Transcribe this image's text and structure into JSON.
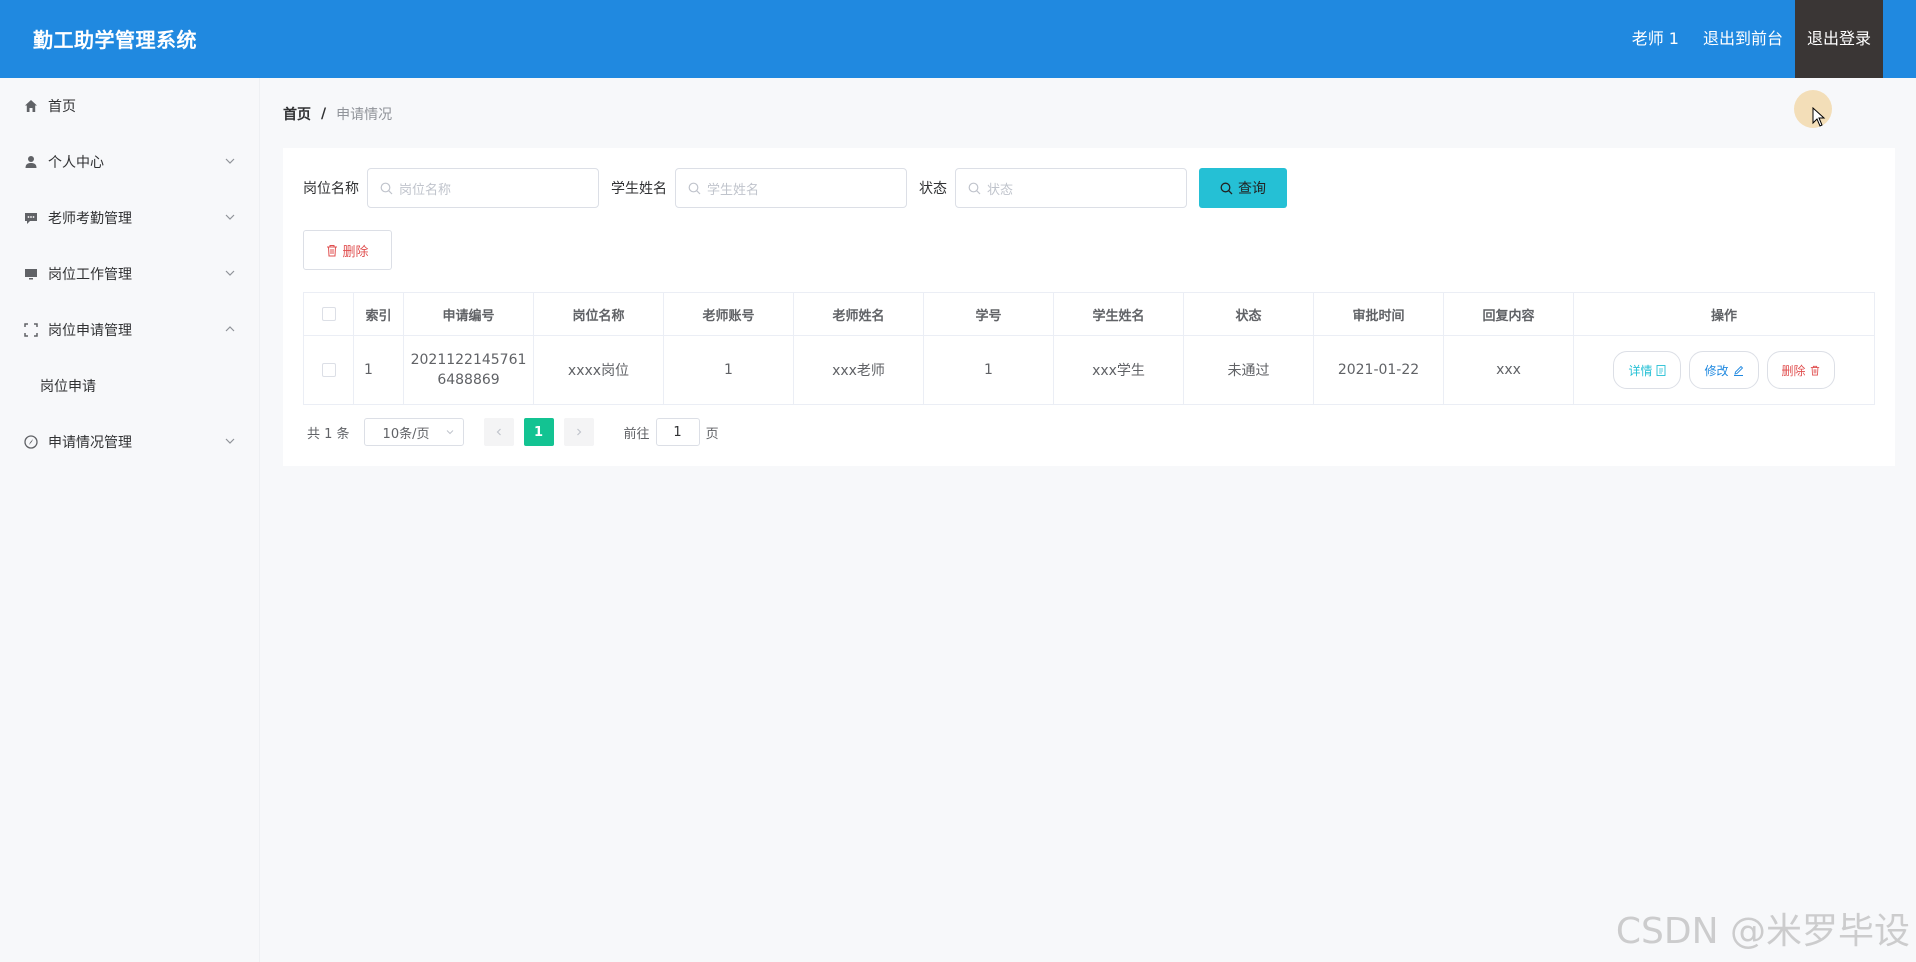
{
  "header": {
    "title": "勤工助学管理系统",
    "user": "老师 1",
    "front_link": "退出到前台",
    "logout": "退出登录",
    "bg_color": "#2089e0"
  },
  "sidebar": {
    "items": [
      {
        "label": "首页",
        "icon": "home-icon"
      },
      {
        "label": "个人中心",
        "icon": "user-icon"
      },
      {
        "label": "老师考勤管理",
        "icon": "chat-icon"
      },
      {
        "label": "岗位工作管理",
        "icon": "monitor-icon"
      },
      {
        "label": "岗位申请管理",
        "icon": "fullscreen-icon",
        "sub": [
          "岗位申请"
        ]
      },
      {
        "label": "申请情况管理",
        "icon": "compass-icon"
      }
    ]
  },
  "breadcrumb": {
    "home": "首页",
    "sep": "/",
    "current": "申请情况"
  },
  "search": {
    "job_label": "岗位名称",
    "job_placeholder": "岗位名称",
    "student_label": "学生姓名",
    "student_placeholder": "学生姓名",
    "status_label": "状态",
    "status_placeholder": "状态",
    "button": "查询"
  },
  "toolbar": {
    "delete": "删除"
  },
  "table": {
    "headers": [
      "索引",
      "申请编号",
      "岗位名称",
      "老师账号",
      "老师姓名",
      "学号",
      "学生姓名",
      "状态",
      "审批时间",
      "回复内容",
      "操作"
    ],
    "rows": [
      {
        "index": "1",
        "app_no_1": "2021122145761",
        "app_no_2": "6488869",
        "job": "xxxx岗位",
        "teacher_acc": "1",
        "teacher_name": "xxx老师",
        "student_no": "1",
        "student_name": "xxx学生",
        "status": "未通过",
        "time": "2021-01-22",
        "reply": "xxx"
      }
    ],
    "ops": {
      "detail": "详情",
      "edit": "修改",
      "delete": "删除"
    }
  },
  "pager": {
    "total": "共 1 条",
    "size": "10条/页",
    "page": "1",
    "goto": "前往",
    "goto_value": "1",
    "page_unit": "页"
  },
  "watermark": "CSDN @米罗毕设"
}
